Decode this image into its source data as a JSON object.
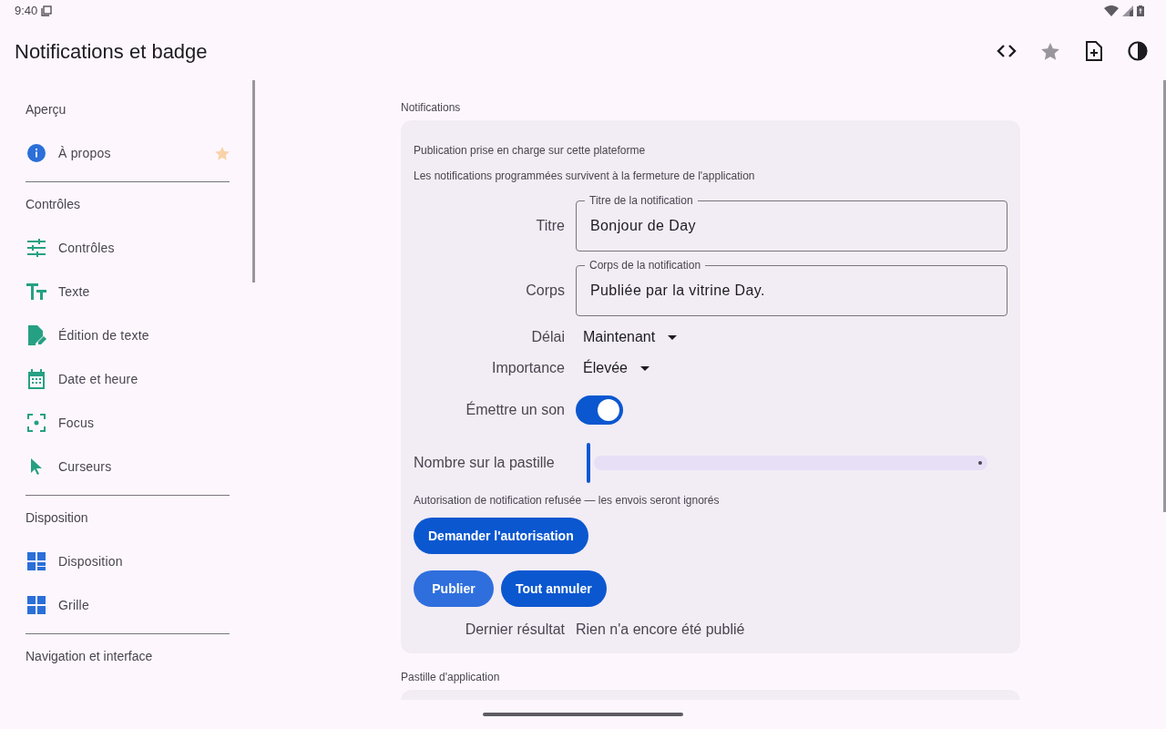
{
  "status_bar": {
    "time": "9:40"
  },
  "app_bar": {
    "title": "Notifications et badge",
    "actions": [
      {
        "kind": "code"
      },
      {
        "kind": "star"
      },
      {
        "kind": "add-file"
      },
      {
        "kind": "contrast"
      }
    ]
  },
  "sidebar": {
    "sections": [
      {
        "title": "Aperçu",
        "items": [
          {
            "label": "À propos",
            "kind": "info",
            "favorite": true
          }
        ]
      },
      {
        "title": "Contrôles",
        "items": [
          {
            "label": "Contrôles",
            "kind": "tune"
          },
          {
            "label": "Texte",
            "kind": "text"
          },
          {
            "label": "Édition de texte",
            "kind": "edit-doc"
          },
          {
            "label": "Date et heure",
            "kind": "calendar"
          },
          {
            "label": "Focus",
            "kind": "focus"
          },
          {
            "label": "Curseurs",
            "kind": "cursor"
          }
        ]
      },
      {
        "title": "Disposition",
        "items": [
          {
            "label": "Disposition",
            "kind": "dashboard"
          },
          {
            "label": "Grille",
            "kind": "grid"
          }
        ]
      },
      {
        "title": "Navigation et interface"
      }
    ]
  },
  "notifications": {
    "heading": "Notifications",
    "info": [
      "Publication prise en charge sur cette plateforme",
      "Les notifications programmées survivent à la fermeture de l'application"
    ],
    "fields": [
      {
        "label": "Titre",
        "floating_label": "Titre de la notification",
        "value": "Bonjour de Day"
      },
      {
        "label": "Corps",
        "floating_label": "Corps de la notification",
        "value": "Publiée par la vitrine Day."
      }
    ],
    "dropdowns": [
      {
        "label": "Délai",
        "value": "Maintenant"
      },
      {
        "label": "Importance",
        "value": "Élevée"
      }
    ],
    "switch": {
      "label": "Émettre un son",
      "on": true
    },
    "slider": {
      "label": "Nombre sur la pastille",
      "level": 0
    },
    "permission_note": "Autorisation de notification refusée — les envois seront ignorés",
    "permission_button": "Demander l'autorisation",
    "buttons": [
      {
        "label": "Publier",
        "focused": true
      },
      {
        "label": "Tout annuler",
        "focused": false
      }
    ],
    "result": {
      "label": "Dernier résultat",
      "value": "Rien n'a encore été publié"
    }
  },
  "badge_section": {
    "heading": "Pastille d'application"
  }
}
